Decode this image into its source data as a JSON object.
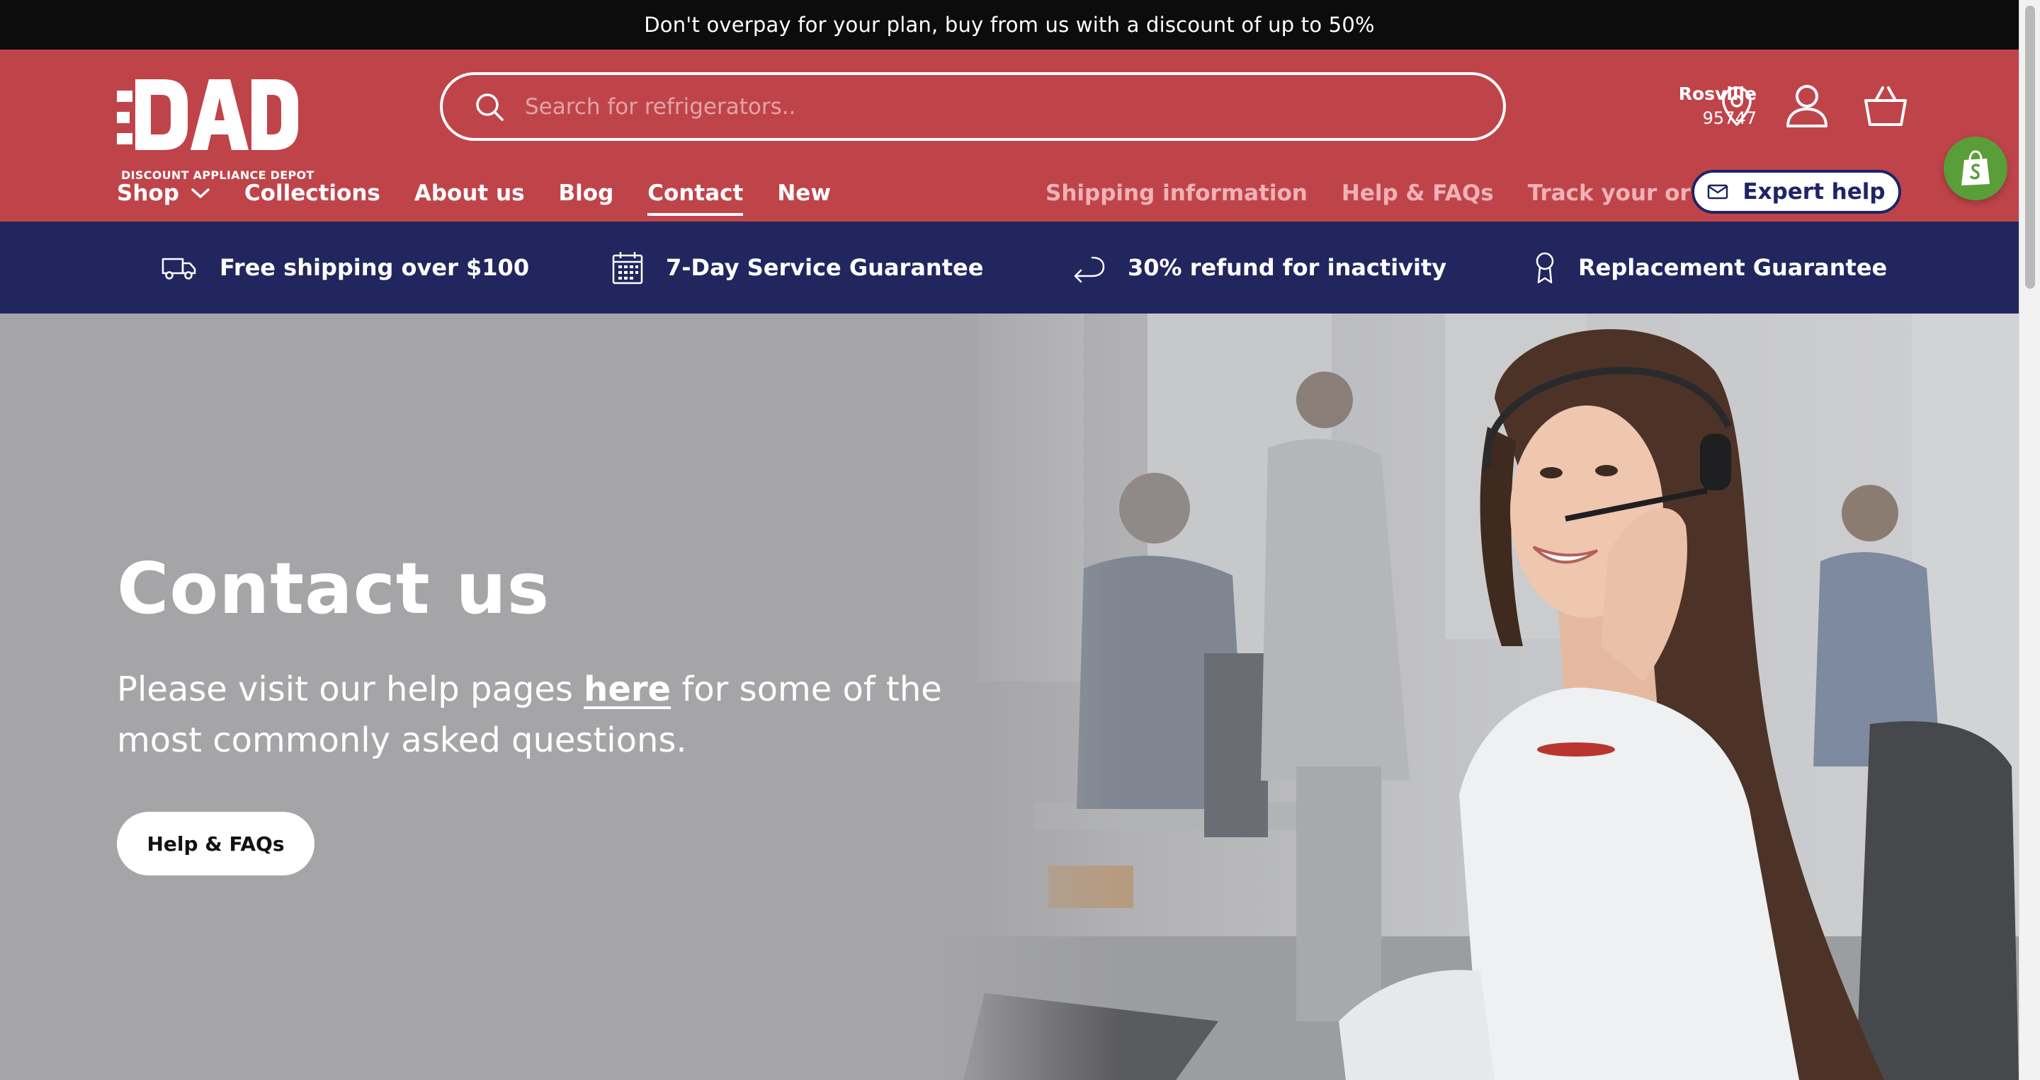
{
  "announcement": "Don't overpay for your plan, buy from us with a discount of up to 50%",
  "logo": {
    "mark": "DAD",
    "subtitle": "DISCOUNT APPLIANCE DEPOT"
  },
  "search": {
    "placeholder": "Search for refrigerators.."
  },
  "location": {
    "city": "Rosville",
    "zip": "95747"
  },
  "nav": {
    "primary": [
      {
        "label": "Shop"
      },
      {
        "label": "Collections"
      },
      {
        "label": "About us"
      },
      {
        "label": "Blog"
      },
      {
        "label": "Contact",
        "active": true
      },
      {
        "label": "New"
      }
    ],
    "secondary": [
      {
        "label": "Shipping information"
      },
      {
        "label": "Help & FAQs"
      },
      {
        "label": "Track your order"
      }
    ],
    "expert_label": "Expert help"
  },
  "usp": [
    {
      "icon": "truck-icon",
      "label": "Free shipping over $100"
    },
    {
      "icon": "calendar-icon",
      "label": "7-Day Service Guarantee"
    },
    {
      "icon": "return-arrow-icon",
      "label": "30% refund for inactivity"
    },
    {
      "icon": "award-ribbon-icon",
      "label": "Replacement Guarantee"
    }
  ],
  "hero": {
    "title": "Contact us",
    "text_before": "Please visit our help pages ",
    "link": "here",
    "text_after": " for some of the most commonly asked questions.",
    "button": "Help & FAQs"
  },
  "colors": {
    "header": "#bf444a",
    "usp_bar": "#22265f",
    "announcement": "#0c0c0c",
    "hero_overlay": "#a5a5a7",
    "shopify_badge": "#5a9e3a"
  }
}
